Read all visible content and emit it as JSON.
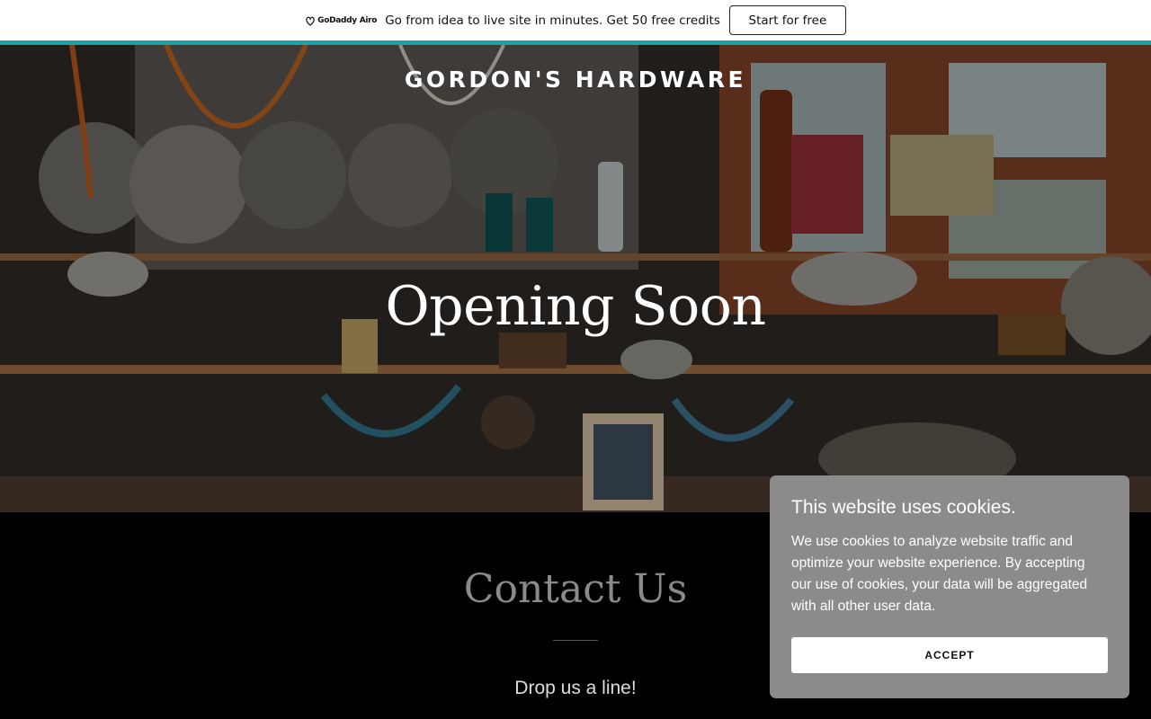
{
  "promo": {
    "logo_text": "GoDaddy Airo",
    "text": "Go from idea to live site in minutes. Get 50 free credits",
    "button_label": "Start for free"
  },
  "hero": {
    "site_title": "GORDON'S HARDWARE",
    "heading": "Opening Soon",
    "image_description_icon": "shop-shelves-image"
  },
  "contact": {
    "title": "Contact Us",
    "subtitle": "Drop us a line!"
  },
  "cookie": {
    "title": "This website uses cookies.",
    "body": "We use cookies to analyze website traffic and optimize your website experience. By accepting our use of cookies, your data will be aggregated with all other user data.",
    "accept_label": "ACCEPT"
  },
  "colors": {
    "accent_teal": "#1aa3a8",
    "cookie_bg": "#8b8b8b"
  }
}
